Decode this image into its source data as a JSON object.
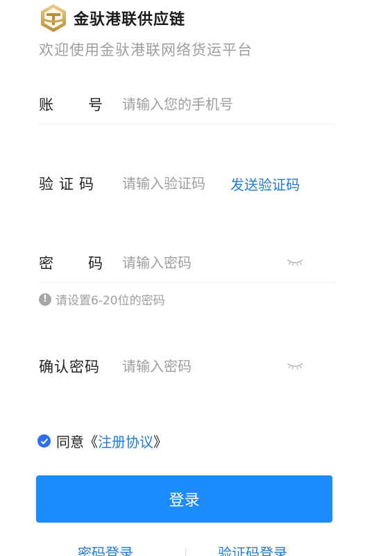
{
  "brand": {
    "name": "金驮港联供应链",
    "logo_icon": "brand-logo"
  },
  "subtitle": "欢迎使用金驮港联网络货运平台",
  "form": {
    "account": {
      "label_chars": [
        "账",
        "号"
      ],
      "placeholder": "请输入您的手机号"
    },
    "code": {
      "label": "验证码",
      "placeholder": "请输入验证码",
      "send_label": "发送验证码"
    },
    "password": {
      "label_chars": [
        "密",
        "码"
      ],
      "placeholder": "请输入密码",
      "hint": "请设置6-20位的密码",
      "hint_icon": "!",
      "toggle_icon": "eye-closed-icon"
    },
    "confirm": {
      "label": "确认密码",
      "placeholder": "请输入密码",
      "toggle_icon": "eye-closed-icon"
    }
  },
  "agreement": {
    "checked": true,
    "prefix": "同意《",
    "link": "注册协议",
    "suffix": "》"
  },
  "login_button": "登录",
  "bottom_links": {
    "password_login": "密码登录",
    "code_login": "验证码登录"
  },
  "colors": {
    "primary": "#1a8cff",
    "link": "#1f7bd6",
    "placeholder": "#9e9e9e",
    "check": "#2e6ff2"
  }
}
